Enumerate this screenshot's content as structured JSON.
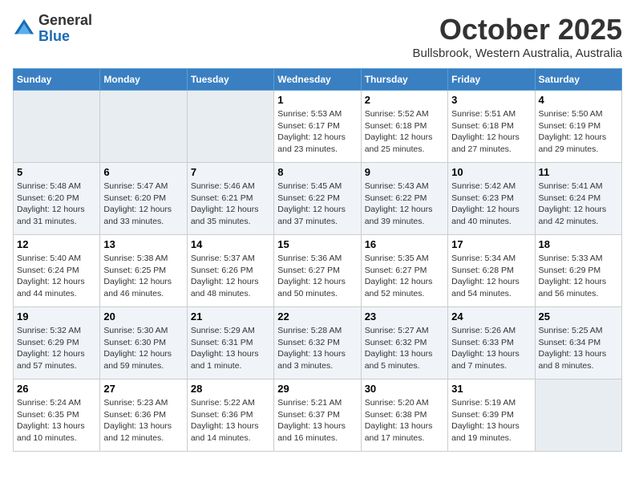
{
  "logo": {
    "general": "General",
    "blue": "Blue"
  },
  "title": "October 2025",
  "subtitle": "Bullsbrook, Western Australia, Australia",
  "headers": [
    "Sunday",
    "Monday",
    "Tuesday",
    "Wednesday",
    "Thursday",
    "Friday",
    "Saturday"
  ],
  "weeks": [
    [
      {
        "day": "",
        "info": ""
      },
      {
        "day": "",
        "info": ""
      },
      {
        "day": "",
        "info": ""
      },
      {
        "day": "1",
        "info": "Sunrise: 5:53 AM\nSunset: 6:17 PM\nDaylight: 12 hours\nand 23 minutes."
      },
      {
        "day": "2",
        "info": "Sunrise: 5:52 AM\nSunset: 6:18 PM\nDaylight: 12 hours\nand 25 minutes."
      },
      {
        "day": "3",
        "info": "Sunrise: 5:51 AM\nSunset: 6:18 PM\nDaylight: 12 hours\nand 27 minutes."
      },
      {
        "day": "4",
        "info": "Sunrise: 5:50 AM\nSunset: 6:19 PM\nDaylight: 12 hours\nand 29 minutes."
      }
    ],
    [
      {
        "day": "5",
        "info": "Sunrise: 5:48 AM\nSunset: 6:20 PM\nDaylight: 12 hours\nand 31 minutes."
      },
      {
        "day": "6",
        "info": "Sunrise: 5:47 AM\nSunset: 6:20 PM\nDaylight: 12 hours\nand 33 minutes."
      },
      {
        "day": "7",
        "info": "Sunrise: 5:46 AM\nSunset: 6:21 PM\nDaylight: 12 hours\nand 35 minutes."
      },
      {
        "day": "8",
        "info": "Sunrise: 5:45 AM\nSunset: 6:22 PM\nDaylight: 12 hours\nand 37 minutes."
      },
      {
        "day": "9",
        "info": "Sunrise: 5:43 AM\nSunset: 6:22 PM\nDaylight: 12 hours\nand 39 minutes."
      },
      {
        "day": "10",
        "info": "Sunrise: 5:42 AM\nSunset: 6:23 PM\nDaylight: 12 hours\nand 40 minutes."
      },
      {
        "day": "11",
        "info": "Sunrise: 5:41 AM\nSunset: 6:24 PM\nDaylight: 12 hours\nand 42 minutes."
      }
    ],
    [
      {
        "day": "12",
        "info": "Sunrise: 5:40 AM\nSunset: 6:24 PM\nDaylight: 12 hours\nand 44 minutes."
      },
      {
        "day": "13",
        "info": "Sunrise: 5:38 AM\nSunset: 6:25 PM\nDaylight: 12 hours\nand 46 minutes."
      },
      {
        "day": "14",
        "info": "Sunrise: 5:37 AM\nSunset: 6:26 PM\nDaylight: 12 hours\nand 48 minutes."
      },
      {
        "day": "15",
        "info": "Sunrise: 5:36 AM\nSunset: 6:27 PM\nDaylight: 12 hours\nand 50 minutes."
      },
      {
        "day": "16",
        "info": "Sunrise: 5:35 AM\nSunset: 6:27 PM\nDaylight: 12 hours\nand 52 minutes."
      },
      {
        "day": "17",
        "info": "Sunrise: 5:34 AM\nSunset: 6:28 PM\nDaylight: 12 hours\nand 54 minutes."
      },
      {
        "day": "18",
        "info": "Sunrise: 5:33 AM\nSunset: 6:29 PM\nDaylight: 12 hours\nand 56 minutes."
      }
    ],
    [
      {
        "day": "19",
        "info": "Sunrise: 5:32 AM\nSunset: 6:29 PM\nDaylight: 12 hours\nand 57 minutes."
      },
      {
        "day": "20",
        "info": "Sunrise: 5:30 AM\nSunset: 6:30 PM\nDaylight: 12 hours\nand 59 minutes."
      },
      {
        "day": "21",
        "info": "Sunrise: 5:29 AM\nSunset: 6:31 PM\nDaylight: 13 hours\nand 1 minute."
      },
      {
        "day": "22",
        "info": "Sunrise: 5:28 AM\nSunset: 6:32 PM\nDaylight: 13 hours\nand 3 minutes."
      },
      {
        "day": "23",
        "info": "Sunrise: 5:27 AM\nSunset: 6:32 PM\nDaylight: 13 hours\nand 5 minutes."
      },
      {
        "day": "24",
        "info": "Sunrise: 5:26 AM\nSunset: 6:33 PM\nDaylight: 13 hours\nand 7 minutes."
      },
      {
        "day": "25",
        "info": "Sunrise: 5:25 AM\nSunset: 6:34 PM\nDaylight: 13 hours\nand 8 minutes."
      }
    ],
    [
      {
        "day": "26",
        "info": "Sunrise: 5:24 AM\nSunset: 6:35 PM\nDaylight: 13 hours\nand 10 minutes."
      },
      {
        "day": "27",
        "info": "Sunrise: 5:23 AM\nSunset: 6:36 PM\nDaylight: 13 hours\nand 12 minutes."
      },
      {
        "day": "28",
        "info": "Sunrise: 5:22 AM\nSunset: 6:36 PM\nDaylight: 13 hours\nand 14 minutes."
      },
      {
        "day": "29",
        "info": "Sunrise: 5:21 AM\nSunset: 6:37 PM\nDaylight: 13 hours\nand 16 minutes."
      },
      {
        "day": "30",
        "info": "Sunrise: 5:20 AM\nSunset: 6:38 PM\nDaylight: 13 hours\nand 17 minutes."
      },
      {
        "day": "31",
        "info": "Sunrise: 5:19 AM\nSunset: 6:39 PM\nDaylight: 13 hours\nand 19 minutes."
      },
      {
        "day": "",
        "info": ""
      }
    ]
  ]
}
